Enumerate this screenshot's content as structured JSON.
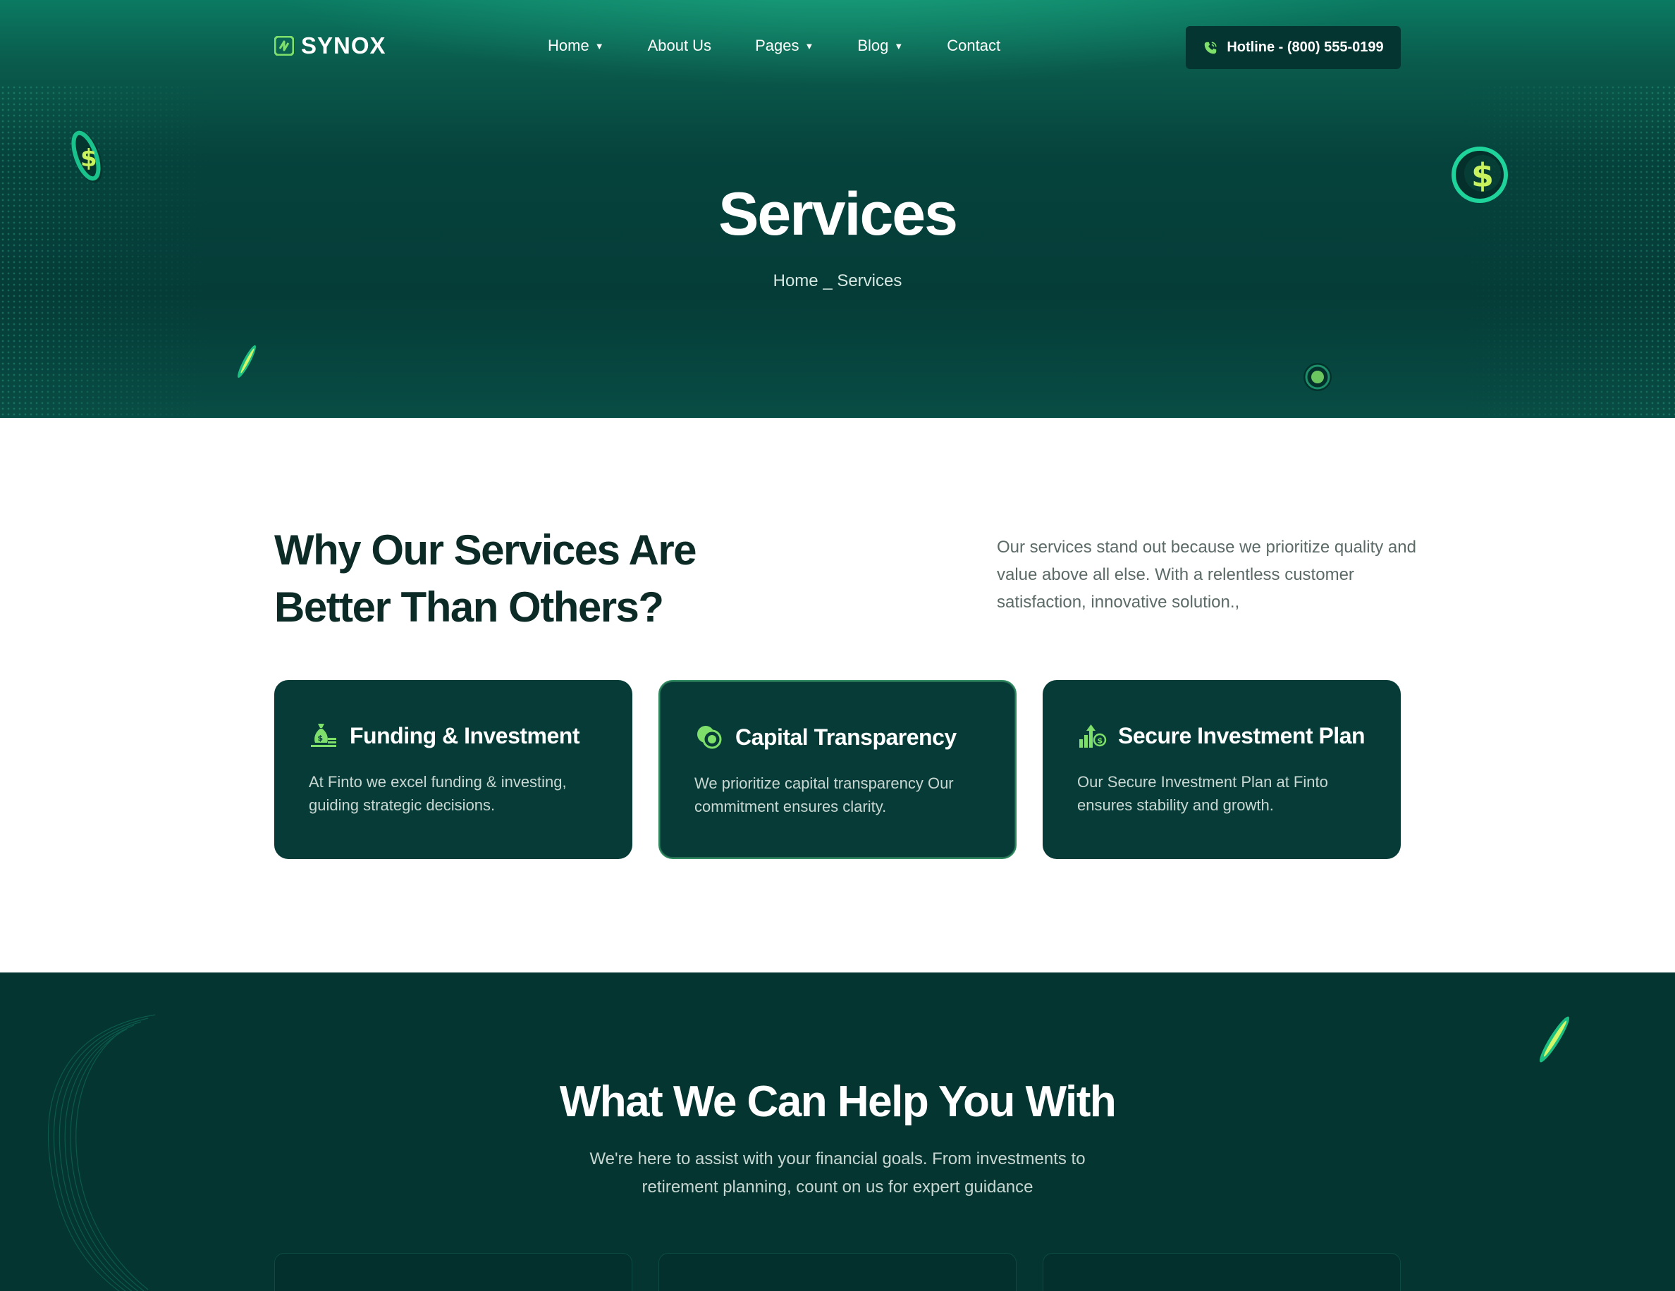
{
  "header": {
    "logo_text": "SYNOX",
    "nav": [
      {
        "label": "Home",
        "caret": "▼"
      },
      {
        "label": "About Us",
        "caret": ""
      },
      {
        "label": "Pages",
        "caret": "▼"
      },
      {
        "label": "Blog",
        "caret": "▼"
      },
      {
        "label": "Contact",
        "caret": ""
      }
    ],
    "hotline": "Hotline - (800) 555-0199"
  },
  "hero": {
    "title": "Services",
    "breadcrumb": "Home _ Services"
  },
  "why": {
    "title_line1": "Why Our Services Are",
    "title_line2": "Better Than Others?",
    "text": "Our services stand out because we prioritize quality and value above all  else. With a relentless customer satisfaction, innovative  solution.,"
  },
  "cards": [
    {
      "icon": "money-bag-icon",
      "title": "Funding & Investment",
      "desc": "At Finto we excel funding & investing, guiding strategic decisions."
    },
    {
      "icon": "coins-icon",
      "title": "Capital Transparency",
      "desc": "We prioritize capital transparency Our commitment ensures clarity."
    },
    {
      "icon": "growth-chart-icon",
      "title": "Secure Investment Plan",
      "desc": "Our Secure Investment Plan at Finto ensures stability and growth."
    }
  ],
  "help": {
    "title": "What We Can Help You With",
    "subtitle": "We're here to assist with your financial goals. From investments to retirement planning, count on us for expert guidance"
  },
  "colors": {
    "brand_dark": "#063b37",
    "accent_green": "#7ee06a",
    "hero_top": "#0b7a62"
  }
}
